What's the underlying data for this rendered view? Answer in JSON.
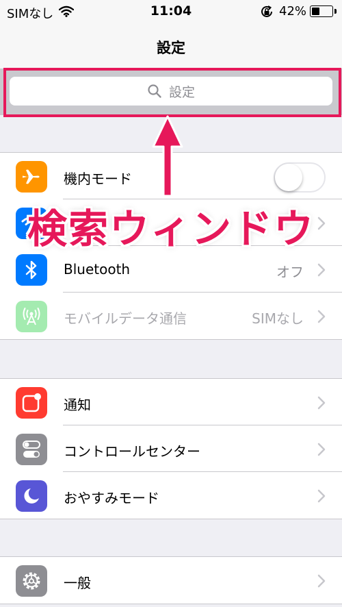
{
  "status_bar": {
    "carrier": "SIMなし",
    "time": "11:04",
    "battery_percent": "42%",
    "battery_level": 0.42
  },
  "nav": {
    "title": "設定"
  },
  "search": {
    "placeholder": "設定"
  },
  "annotation": {
    "text": "検索ウィンドウ",
    "color": "#e6185a"
  },
  "groups": [
    {
      "rows": [
        {
          "label": "機内モード",
          "icon": "airplane-icon",
          "color": "#ff9500",
          "control": "toggle",
          "toggle_on": false
        },
        {
          "label": "",
          "icon": "wifi-icon",
          "color": "#007aff",
          "control": "chevron"
        },
        {
          "label": "Bluetooth",
          "value": "オフ",
          "icon": "bluetooth-icon",
          "color": "#007aff",
          "control": "chevron"
        },
        {
          "label": "モバイルデータ通信",
          "value": "SIMなし",
          "icon": "cellular-antenna-icon",
          "color": "#4cd964",
          "control": "chevron",
          "disabled": true
        }
      ]
    },
    {
      "rows": [
        {
          "label": "通知",
          "icon": "notifications-icon",
          "color": "#ff3b30",
          "control": "chevron"
        },
        {
          "label": "コントロールセンター",
          "icon": "control-center-icon",
          "color": "#8e8e93",
          "control": "chevron"
        },
        {
          "label": "おやすみモード",
          "icon": "moon-icon",
          "color": "#5856d6",
          "control": "chevron"
        }
      ]
    },
    {
      "rows": [
        {
          "label": "一般",
          "icon": "gear-icon",
          "color": "#8e8e93",
          "control": "chevron"
        }
      ]
    }
  ]
}
